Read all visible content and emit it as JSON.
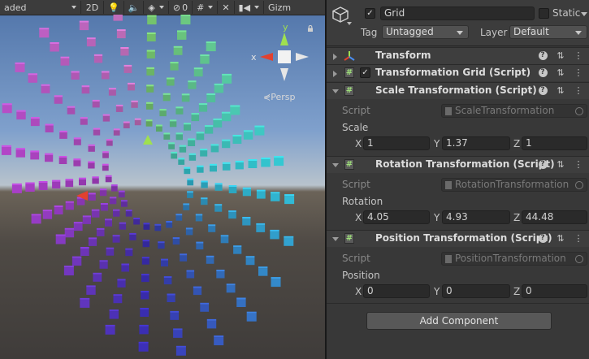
{
  "toolbar": {
    "shading_mode": "aded",
    "mode_2d": "2D",
    "hidden_count": "0",
    "gizmos": "Gizm"
  },
  "scene": {
    "projection_label": "Persp",
    "gizmo_axes": {
      "x": "x",
      "y": "y"
    },
    "icons": [
      "light-icon",
      "audio-icon",
      "effects-icon",
      "visibility-icon",
      "grid-icon",
      "tools-icon",
      "camera-icon",
      "lock-icon"
    ]
  },
  "inspector": {
    "object_name": "Grid",
    "active": true,
    "static_label": "Static",
    "tag_label": "Tag",
    "tag_value": "Untagged",
    "layer_label": "Layer",
    "layer_value": "Default",
    "components": {
      "transform": {
        "title": "Transform"
      },
      "transformation_grid": {
        "title": "Transformation Grid (Script)",
        "enabled": true
      },
      "scale": {
        "title": "Scale Transformation (Script)",
        "script_label": "Script",
        "script_value": "ScaleTransformation",
        "field_label": "Scale",
        "x": "1",
        "y": "1.37",
        "z": "1"
      },
      "rotation": {
        "title": "Rotation Transformation (Script)",
        "script_label": "Script",
        "script_value": "RotationTransformation",
        "field_label": "Rotation",
        "x": "4.05",
        "y": "4.93",
        "z": "44.48"
      },
      "position": {
        "title": "Position Transformation (Script)",
        "script_label": "Script",
        "script_value": "PositionTransformation",
        "field_label": "Position",
        "x": "0",
        "y": "0",
        "z": "0"
      }
    },
    "axis_labels": {
      "x": "X",
      "y": "Y",
      "z": "Z"
    },
    "add_component": "Add Component"
  },
  "colors": {
    "cube_top": "#3a2fb8",
    "cube_left": "#b040c8",
    "cube_right": "#30c8d8",
    "cube_center": "#9fe050",
    "gizmo_y": "#9fe050",
    "gizmo_x": "#e2412f"
  }
}
